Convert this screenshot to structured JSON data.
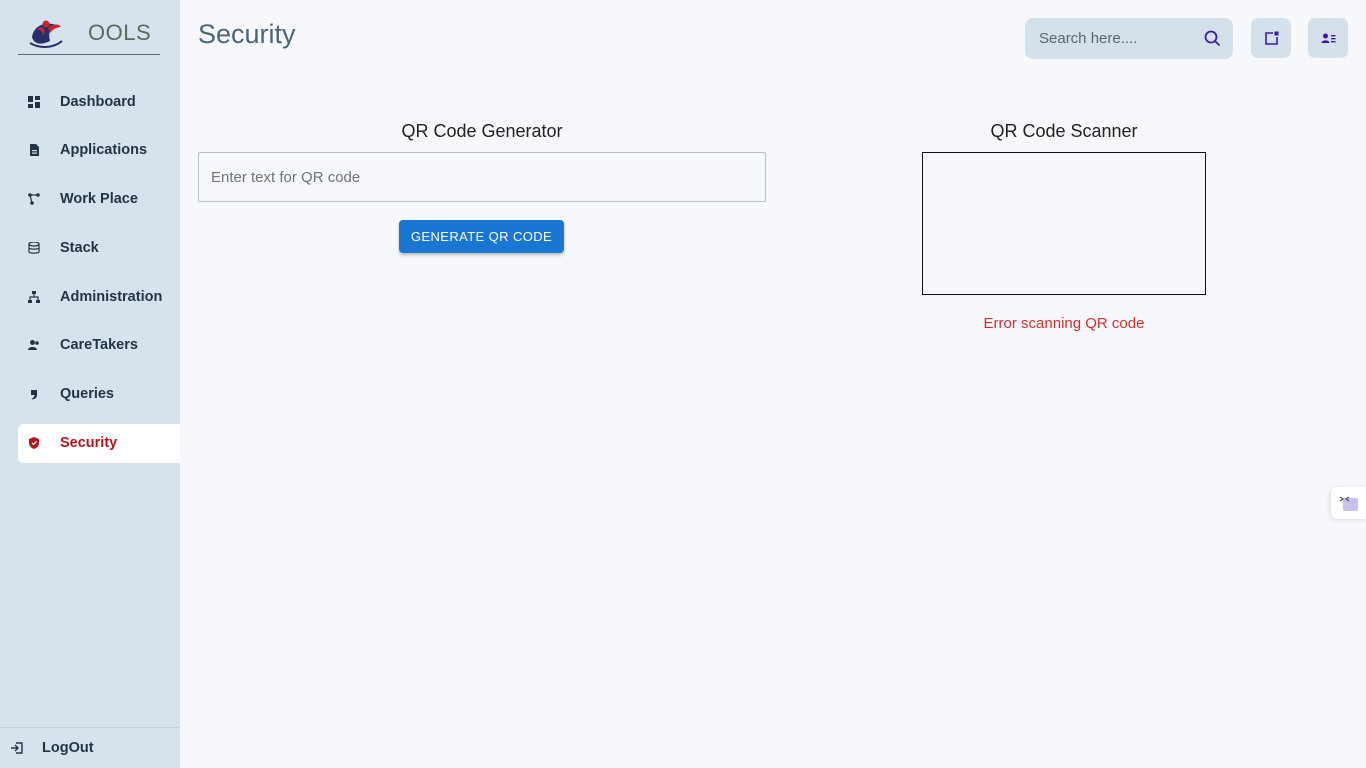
{
  "brand": {
    "text": "OOLS"
  },
  "sidebar": {
    "items": [
      {
        "label": "Dashboard",
        "icon": "dashboard-icon",
        "active": false
      },
      {
        "label": "Applications",
        "icon": "document-icon",
        "active": false
      },
      {
        "label": "Work Place",
        "icon": "workflow-icon",
        "active": false
      },
      {
        "label": "Stack",
        "icon": "database-icon",
        "active": false
      },
      {
        "label": "Administration",
        "icon": "hierarchy-icon",
        "active": false
      },
      {
        "label": "CareTakers",
        "icon": "users-icon",
        "active": false
      },
      {
        "label": "Queries",
        "icon": "quote-icon",
        "active": false
      },
      {
        "label": "Security",
        "icon": "shield-icon",
        "active": true
      }
    ],
    "logout_label": "LogOut"
  },
  "header": {
    "title": "Security",
    "search_placeholder": "Search here...."
  },
  "generator": {
    "title": "QR Code Generator",
    "input_placeholder": "Enter text for QR code",
    "button_label": "GENERATE QR CODE"
  },
  "scanner": {
    "title": "QR Code Scanner",
    "error_text": "Error scanning QR code"
  },
  "colors": {
    "sidebar_bg": "#d7e3ec",
    "active_text": "#b5141e",
    "primary_button": "#1976d2",
    "error": "#d32f2f",
    "header_icon": "#3f1aa8"
  }
}
